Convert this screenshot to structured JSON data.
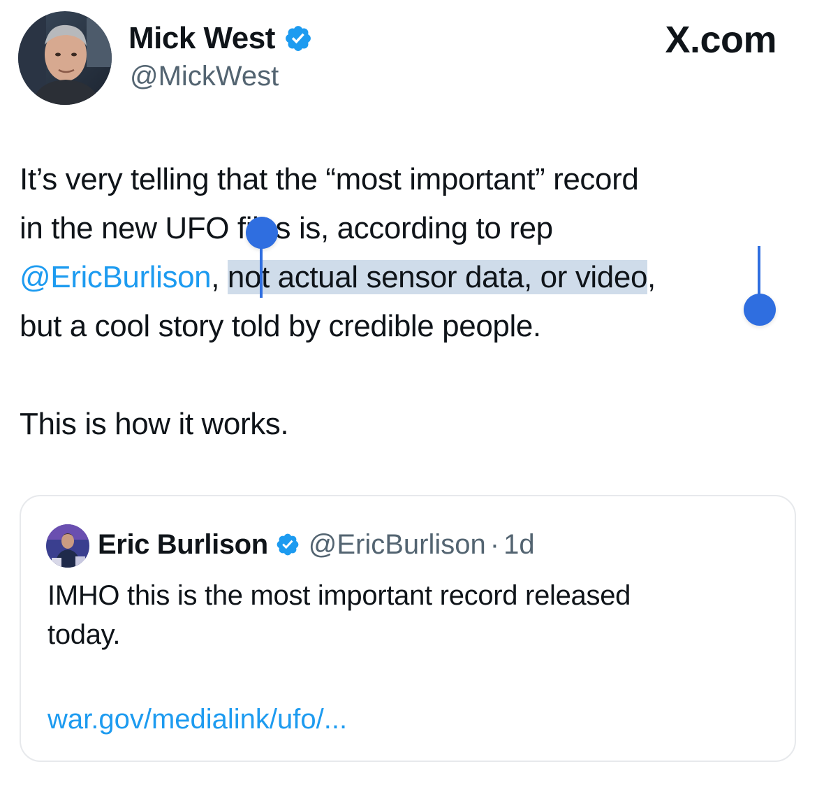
{
  "brand": {
    "label": "X.com"
  },
  "author": {
    "name": "Mick West",
    "handle": "@MickWest",
    "verified_icon": "verified-badge-icon",
    "verified_color": "#1d9bf0"
  },
  "tweet": {
    "line1": "It’s very telling that the “most important” record",
    "line2": "in the new UFO files is, according to rep",
    "mention": "@EricBurlison",
    "mention_suffix": ", ",
    "selected_text": "not actual sensor data, or video",
    "after_selection": ",",
    "line4": "but a cool story told by credible people.",
    "line6": "This is how it works."
  },
  "quote": {
    "name": "Eric Burlison",
    "handle": "@EricBurlison",
    "separator": "·",
    "time": "1d",
    "text_line1": "IMHO this is the most important record released",
    "text_line2": "today.",
    "link": "war.gov/medialink/ufo/..."
  },
  "colors": {
    "link": "#1d9bf0",
    "selection": "#cfdcea",
    "selection_handle": "#2f6ee0",
    "secondary_text": "#536471"
  }
}
